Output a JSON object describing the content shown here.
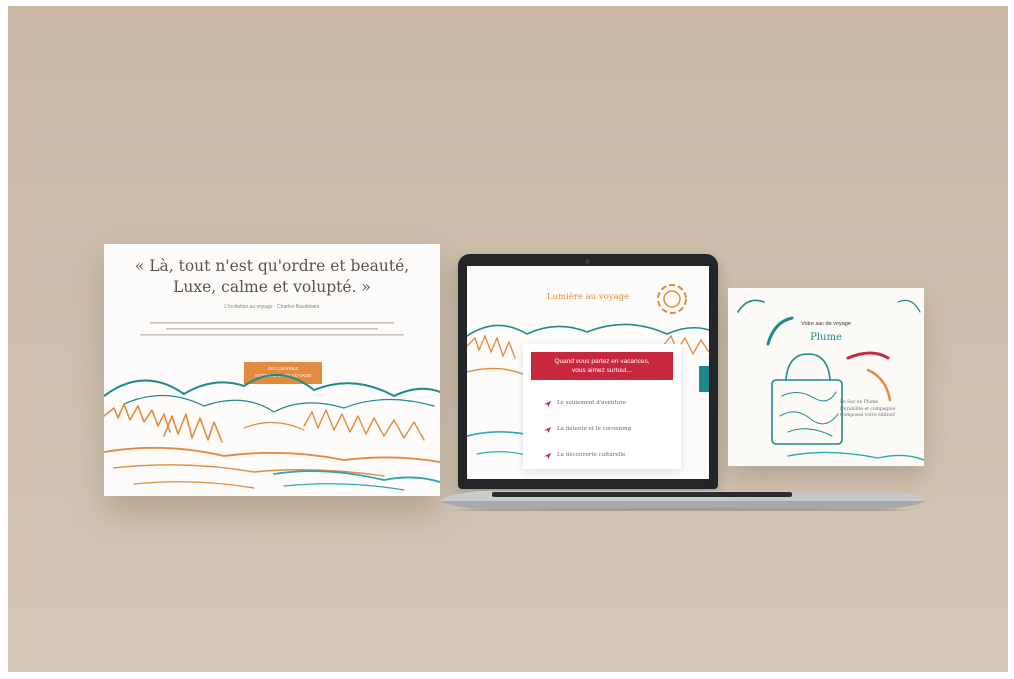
{
  "left_card": {
    "quote_line1": "« Là, tout n'est qu'ordre et beauté,",
    "quote_line2": "Luxe, calme et volupté. »",
    "quote_source": "L'Invitation au voyage · Charles Baudelaire",
    "cta_line1": "DÉCOUVREZ",
    "cta_line2": "VOTRE SAC DE VOYAGE"
  },
  "laptop_screen": {
    "title": "Lumière au voyage",
    "banner_line1": "Quand vous partez en vacances,",
    "banner_line2": "vous aimez surtout...",
    "options": [
      "Le seulement d'aventure",
      "La détente et le cocooning",
      "La découverte culturelle"
    ]
  },
  "right_card": {
    "label": "Votre sac de voyage",
    "name": "Plume",
    "info_line1": "Le Sac en Plume",
    "info_line2": "Durabilité et compagnie",
    "info_line3": "Composez votre édition!"
  },
  "colors": {
    "background": "#cdbdab",
    "accent_orange": "#e38a3d",
    "accent_teal": "#1e8a8c",
    "accent_red": "#c7283e"
  }
}
